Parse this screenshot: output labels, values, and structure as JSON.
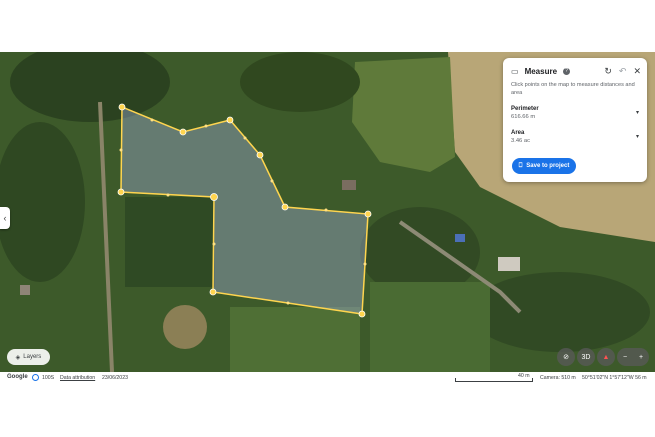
{
  "map": {
    "polygon_color": "#ffd54f",
    "fill_color": "rgba(140,160,200,0.45)"
  },
  "panel": {
    "title": "Measure",
    "description": "Click points on the map to measure distances and area",
    "perimeter_label": "Perimeter",
    "perimeter_value": "616.66 m",
    "area_label": "Area",
    "area_value": "3.46 ac",
    "save_label": "Save to project",
    "icons": [
      "ruler-icon",
      "help-icon",
      "refresh-icon",
      "undo-icon",
      "close-icon"
    ]
  },
  "controls": {
    "layers_label": "Layers",
    "view_3d_label": "3D",
    "zoom_in": "+",
    "zoom_out": "−"
  },
  "footer": {
    "google": "Google",
    "imagery_year": "100S",
    "data_attribution": "Data attribution",
    "date": "23/06/2023",
    "scale_label": "40 m",
    "camera": "Camera: 510 m",
    "coordinates": "50°51'02\"N 1°57'12\"W  56 m"
  }
}
